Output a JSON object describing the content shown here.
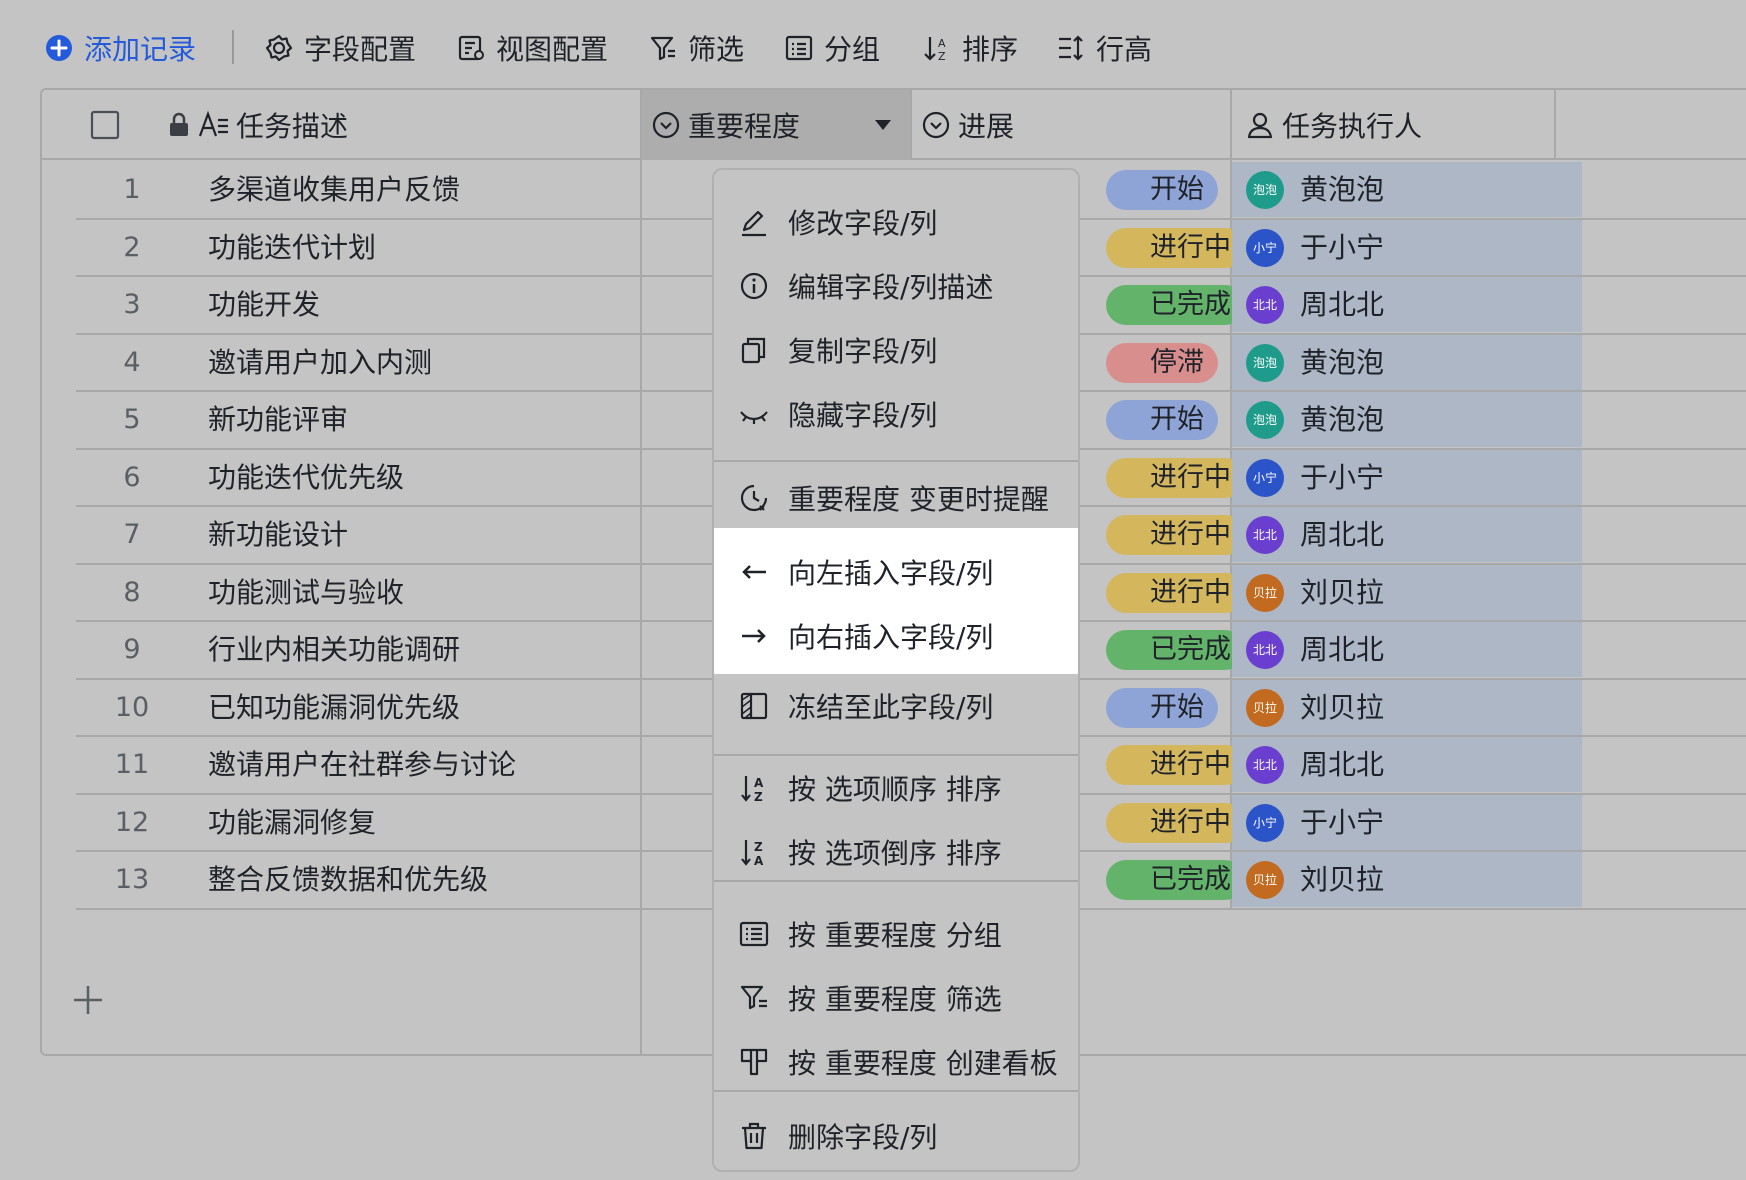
{
  "toolbar": {
    "add_record": "添加记录",
    "field_config": "字段配置",
    "view_config": "视图配置",
    "filter": "筛选",
    "group": "分组",
    "sort": "排序",
    "row_height": "行高"
  },
  "columns": {
    "task_desc": "任务描述",
    "importance": "重要程度",
    "progress": "进展",
    "assignee": "任务执行人"
  },
  "rows": [
    {
      "num": "1",
      "desc": "多渠道收集用户反馈",
      "progress": "开始",
      "progress_color": "#8fa4d6",
      "assignee": "黄泡泡",
      "avatar": "泡泡",
      "avatar_color": "#1f9b8b"
    },
    {
      "num": "2",
      "desc": "功能迭代计划",
      "progress": "进行中",
      "progress_color": "#d4b65c",
      "assignee": "于小宁",
      "avatar": "小宁",
      "avatar_color": "#2b54c8"
    },
    {
      "num": "3",
      "desc": "功能开发",
      "progress": "已完成",
      "progress_color": "#63b36b",
      "assignee": "周北北",
      "avatar": "北北",
      "avatar_color": "#6a3fcf"
    },
    {
      "num": "4",
      "desc": "邀请用户加入内测",
      "progress": "停滞",
      "progress_color": "#d98e8e",
      "assignee": "黄泡泡",
      "avatar": "泡泡",
      "avatar_color": "#1f9b8b"
    },
    {
      "num": "5",
      "desc": "新功能评审",
      "progress": "开始",
      "progress_color": "#8fa4d6",
      "assignee": "黄泡泡",
      "avatar": "泡泡",
      "avatar_color": "#1f9b8b"
    },
    {
      "num": "6",
      "desc": "功能迭代优先级",
      "progress": "进行中",
      "progress_color": "#d4b65c",
      "assignee": "于小宁",
      "avatar": "小宁",
      "avatar_color": "#2b54c8"
    },
    {
      "num": "7",
      "desc": "新功能设计",
      "progress": "进行中",
      "progress_color": "#d4b65c",
      "assignee": "周北北",
      "avatar": "北北",
      "avatar_color": "#6a3fcf"
    },
    {
      "num": "8",
      "desc": "功能测试与验收",
      "progress": "进行中",
      "progress_color": "#d4b65c",
      "assignee": "刘贝拉",
      "avatar": "贝拉",
      "avatar_color": "#c26a1f"
    },
    {
      "num": "9",
      "desc": "行业内相关功能调研",
      "progress": "已完成",
      "progress_color": "#63b36b",
      "assignee": "周北北",
      "avatar": "北北",
      "avatar_color": "#6a3fcf"
    },
    {
      "num": "10",
      "desc": "已知功能漏洞优先级",
      "progress": "开始",
      "progress_color": "#8fa4d6",
      "assignee": "刘贝拉",
      "avatar": "贝拉",
      "avatar_color": "#c26a1f"
    },
    {
      "num": "11",
      "desc": "邀请用户在社群参与讨论",
      "progress": "进行中",
      "progress_color": "#d4b65c",
      "assignee": "周北北",
      "avatar": "北北",
      "avatar_color": "#6a3fcf"
    },
    {
      "num": "12",
      "desc": "功能漏洞修复",
      "progress": "进行中",
      "progress_color": "#d4b65c",
      "assignee": "于小宁",
      "avatar": "小宁",
      "avatar_color": "#2b54c8"
    },
    {
      "num": "13",
      "desc": "整合反馈数据和优先级",
      "progress": "已完成",
      "progress_color": "#63b36b",
      "assignee": "刘贝拉",
      "avatar": "贝拉",
      "avatar_color": "#c26a1f"
    }
  ],
  "menu": {
    "edit_field": "修改字段/列",
    "edit_desc": "编辑字段/列描述",
    "copy_field": "复制字段/列",
    "hide_field": "隐藏字段/列",
    "remind": "重要程度 变更时提醒",
    "insert_left": "向左插入字段/列",
    "insert_right": "向右插入字段/列",
    "freeze": "冻结至此字段/列",
    "sort_asc": "按 选项顺序 排序",
    "sort_desc": "按 选项倒序 排序",
    "group_by": "按 重要程度 分组",
    "filter_by": "按 重要程度 筛选",
    "kanban": "按 重要程度 创建看板",
    "delete_field": "删除字段/列"
  }
}
